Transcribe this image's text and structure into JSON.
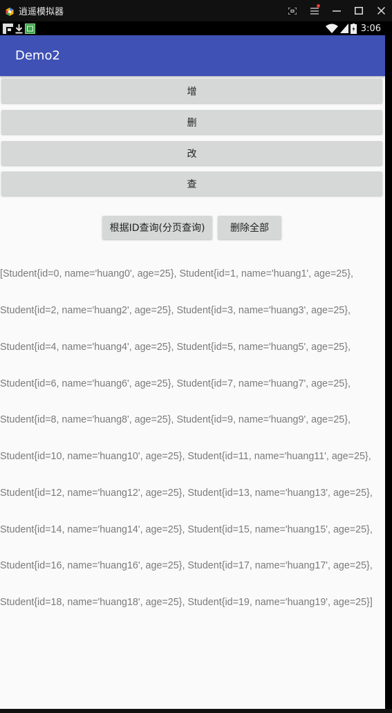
{
  "window": {
    "title": "逍遥模拟器"
  },
  "status_bar": {
    "time": "3:06",
    "icons": [
      "notification-f-icon",
      "download-icon",
      "sim-icon",
      "wifi-icon",
      "signal-icon",
      "battery-icon"
    ]
  },
  "app_bar": {
    "title": "Demo2",
    "color": "#3f51b5"
  },
  "buttons": {
    "add": "增",
    "delete": "删",
    "update": "改",
    "query": "查",
    "query_by_id": "根据ID查询(分页查询)",
    "delete_all": "删除全部"
  },
  "result": {
    "lines": [
      "[Student{id=0, name='huang0', age=25}, Student{id=1, name='huang1', age=25},",
      "Student{id=2, name='huang2', age=25}, Student{id=3, name='huang3', age=25},",
      "Student{id=4, name='huang4', age=25}, Student{id=5, name='huang5', age=25},",
      "Student{id=6, name='huang6', age=25}, Student{id=7, name='huang7', age=25},",
      "Student{id=8, name='huang8', age=25}, Student{id=9, name='huang9', age=25},",
      "Student{id=10, name='huang10', age=25}, Student{id=11, name='huang11', age=25},",
      "Student{id=12, name='huang12', age=25}, Student{id=13, name='huang13', age=25},",
      "Student{id=14, name='huang14', age=25}, Student{id=15, name='huang15', age=25},",
      "Student{id=16, name='huang16', age=25}, Student{id=17, name='huang17', age=25},",
      "Student{id=18, name='huang18', age=25}, Student{id=19, name='huang19', age=25}]"
    ]
  }
}
